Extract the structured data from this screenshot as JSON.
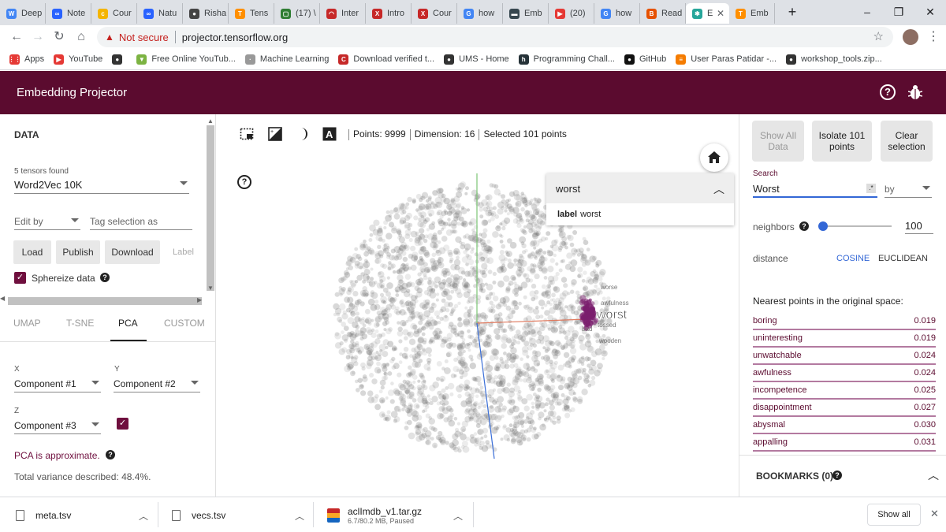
{
  "browser": {
    "tabs": [
      {
        "label": "Deep",
        "color": "#4285f4",
        "glyph": "W"
      },
      {
        "label": "Note",
        "color": "#2962ff",
        "glyph": "∞"
      },
      {
        "label": "Cour",
        "color": "#f4b400",
        "glyph": "c"
      },
      {
        "label": "Natu",
        "color": "#2962ff",
        "glyph": "∞"
      },
      {
        "label": "Risha",
        "color": "#444",
        "glyph": "●"
      },
      {
        "label": "Tens",
        "color": "#ff8f00",
        "glyph": "T"
      },
      {
        "label": "(17) \\",
        "color": "#2e7d32",
        "glyph": "▢"
      },
      {
        "label": "Inter",
        "color": "#c62828",
        "glyph": "◠"
      },
      {
        "label": "Intro",
        "color": "#c62828",
        "glyph": "X"
      },
      {
        "label": "Cour",
        "color": "#c62828",
        "glyph": "X"
      },
      {
        "label": "how",
        "color": "#4285f4",
        "glyph": "G"
      },
      {
        "label": "Emb",
        "color": "#37474f",
        "glyph": "▬"
      },
      {
        "label": "(20)",
        "color": "#e53935",
        "glyph": "▶"
      },
      {
        "label": "how",
        "color": "#4285f4",
        "glyph": "G"
      },
      {
        "label": "Read",
        "color": "#e65100",
        "glyph": "B"
      },
      {
        "label": "E",
        "color": "#26a69a",
        "glyph": "✱",
        "active": true
      },
      {
        "label": "Emb",
        "color": "#ff8f00",
        "glyph": "T"
      }
    ],
    "new_tab": "+",
    "window_controls": [
      "–",
      "❐",
      "✕"
    ],
    "not_secure": "Not secure",
    "url": "projector.tensorflow.org",
    "bookmarks": [
      {
        "label": "Apps",
        "color": "#e53935",
        "glyph": "⋮⋮"
      },
      {
        "label": "YouTube",
        "color": "#e53935",
        "glyph": "▶"
      },
      {
        "label": "",
        "color": "#333",
        "glyph": "●"
      },
      {
        "label": "Free Online YouTub...",
        "color": "#7cb342",
        "glyph": "▼"
      },
      {
        "label": "Machine Learning",
        "color": "#999",
        "glyph": "·"
      },
      {
        "label": "Download verified t...",
        "color": "#c62828",
        "glyph": "C"
      },
      {
        "label": "UMS - Home",
        "color": "#333",
        "glyph": "●"
      },
      {
        "label": "Programming Chall...",
        "color": "#263238",
        "glyph": "h"
      },
      {
        "label": "GitHub",
        "color": "#111",
        "glyph": "●"
      },
      {
        "label": "User Paras Patidar -...",
        "color": "#f57c00",
        "glyph": "≡"
      },
      {
        "label": "workshop_tools.zip...",
        "color": "#333",
        "glyph": "●"
      }
    ]
  },
  "app": {
    "title": "Embedding Projector"
  },
  "left": {
    "section_title": "DATA",
    "tensors_found": "5 tensors found",
    "tensor_select": "Word2Vec 10K",
    "edit_by": "Edit by",
    "tag_selection": "Tag selection as",
    "load": "Load",
    "publish": "Publish",
    "download": "Download",
    "label": "Label",
    "sphereize": "Sphereize data",
    "tabs": [
      "UMAP",
      "T-SNE",
      "PCA",
      "CUSTOM"
    ],
    "active_tab": "PCA",
    "x_label": "X",
    "y_label": "Y",
    "z_label": "Z",
    "x_comp": "Component #1",
    "y_comp": "Component #2",
    "z_comp": "Component #3",
    "pca_approx": "PCA is approximate.",
    "variance": "Total variance described: 48.4%."
  },
  "center": {
    "points": "Points: 9999",
    "dimension": "Dimension: 16",
    "selected": "Selected 101 points",
    "popup_title": "worst",
    "popup_label_key": "label",
    "popup_label_value": "worst",
    "main_label": "worst",
    "neighbor_labels": [
      "worse",
      "awfulness",
      "tossed",
      "wooden",
      "bad"
    ]
  },
  "right": {
    "show_all": "Show All Data",
    "isolate": "Isolate 101 points",
    "clear": "Clear selection",
    "search_label": "Search",
    "search_value": "Worst",
    "regex": ".*",
    "by": "by",
    "neighbors_label": "neighbors",
    "neighbors_value": "100",
    "neighbors_fraction": 0.05,
    "distance_label": "distance",
    "cosine": "COSINE",
    "euclidean": "EUCLIDEAN",
    "nearest_title": "Nearest points in the original space:",
    "nearest": [
      {
        "word": "boring",
        "value": "0.019"
      },
      {
        "word": "uninteresting",
        "value": "0.019"
      },
      {
        "word": "unwatchable",
        "value": "0.024"
      },
      {
        "word": "awfulness",
        "value": "0.024"
      },
      {
        "word": "incompetence",
        "value": "0.025"
      },
      {
        "word": "disappointment",
        "value": "0.027"
      },
      {
        "word": "abysmal",
        "value": "0.030"
      },
      {
        "word": "appalling",
        "value": "0.031"
      }
    ],
    "bookmarks": "BOOKMARKS (0)"
  },
  "downloads": {
    "items": [
      {
        "name": "meta.tsv",
        "status": ""
      },
      {
        "name": "vecs.tsv",
        "status": ""
      },
      {
        "name": "aclImdb_v1.tar.gz",
        "status": "6.7/80.2 MB, Paused"
      }
    ],
    "show_all": "Show all"
  }
}
